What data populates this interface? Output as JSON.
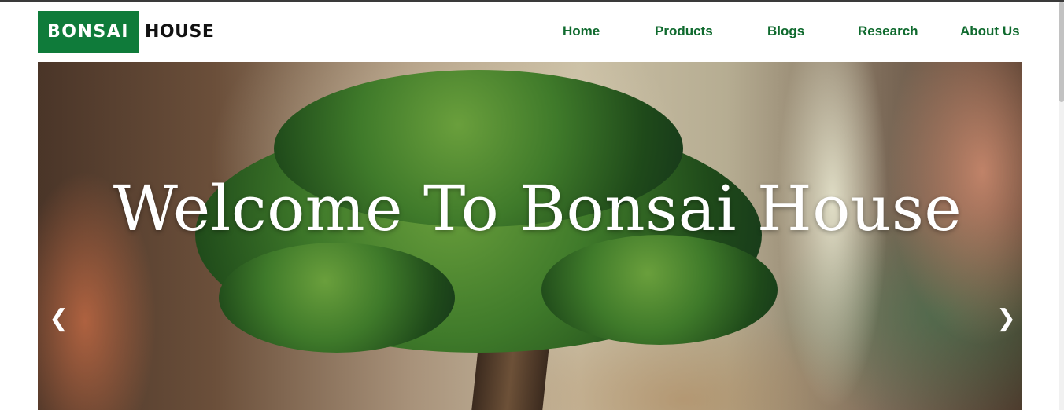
{
  "brand": {
    "badge_text": "BONSAI",
    "word_text": "HOUSE",
    "badge_color": "#0f7b3a"
  },
  "nav": {
    "items": [
      {
        "label": "Home"
      },
      {
        "label": "Products"
      },
      {
        "label": "Blogs"
      },
      {
        "label": "Research"
      },
      {
        "label": "About Us"
      }
    ],
    "link_color": "#0f6a2e"
  },
  "hero": {
    "title": "Welcome To Bonsai House",
    "prev_symbol": "❮",
    "next_symbol": "❯"
  }
}
